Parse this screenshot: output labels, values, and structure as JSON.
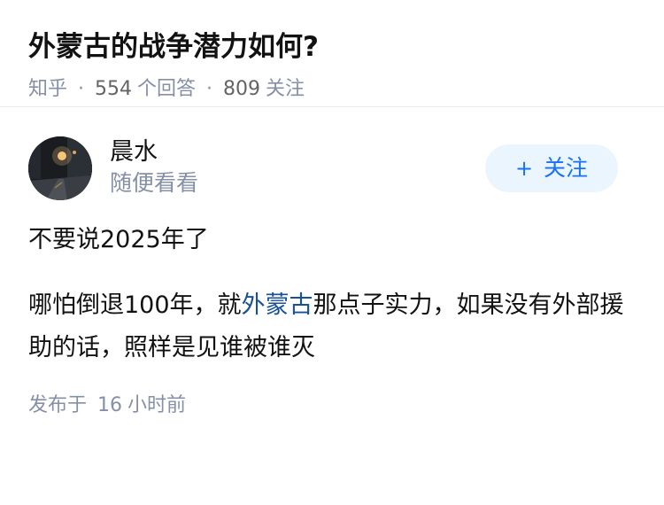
{
  "question": {
    "title": "外蒙古的战争潜力如何?",
    "source": "知乎",
    "dot": "·",
    "answer_count": "554",
    "answer_label": "个回答",
    "follow_count": "809",
    "follow_label": "关注"
  },
  "author": {
    "name": "晨水",
    "bio": "随便看看",
    "follow_button_icon": "+",
    "follow_button_label": "关注"
  },
  "answer": {
    "paragraph_1": "不要说2025年了",
    "paragraph_2_before": "哪怕倒退100年，就",
    "paragraph_2_link": "外蒙古",
    "paragraph_2_after": "那点子实力，如果没有外部援助的话，照样是见谁被谁灭",
    "publish_label": "发布于",
    "publish_number": "16",
    "publish_unit": "小时前"
  },
  "colors": {
    "link": "#175199",
    "follow_text": "#1772f6",
    "follow_bg": "#ebf5fd",
    "meta_gray": "#8590a6"
  }
}
